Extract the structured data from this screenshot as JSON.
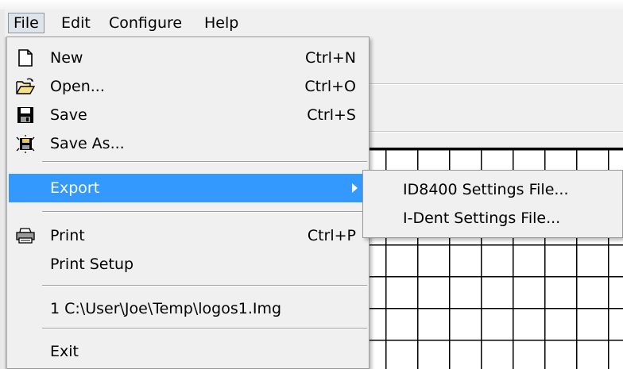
{
  "menubar": {
    "items": [
      {
        "label": "File",
        "active": true
      },
      {
        "label": "Edit",
        "active": false
      },
      {
        "label": "Configure",
        "active": false
      },
      {
        "label": "Help",
        "active": false
      }
    ]
  },
  "file_menu": {
    "new": {
      "label": "New",
      "shortcut": "Ctrl+N",
      "icon": "new-document-icon"
    },
    "open": {
      "label": "Open...",
      "shortcut": "Ctrl+O",
      "icon": "open-folder-icon"
    },
    "save": {
      "label": "Save",
      "shortcut": "Ctrl+S",
      "icon": "floppy-disk-icon"
    },
    "save_as": {
      "label": "Save As...",
      "icon": "save-as-icon"
    },
    "export": {
      "label": "Export",
      "highlighted": true
    },
    "print": {
      "label": "Print",
      "shortcut": "Ctrl+P",
      "icon": "printer-icon"
    },
    "print_setup": {
      "label": "Print Setup"
    },
    "recent": {
      "label": "1 C:\\User\\Joe\\Temp\\logos1.Img"
    },
    "exit": {
      "label": "Exit"
    }
  },
  "export_submenu": {
    "items": [
      {
        "label": "ID8400 Settings File..."
      },
      {
        "label": "I-Dent Settings File..."
      }
    ]
  },
  "colors": {
    "menu_bg": "#f0f0f0",
    "highlight": "#3399ff",
    "grid_lines": "#000000"
  }
}
